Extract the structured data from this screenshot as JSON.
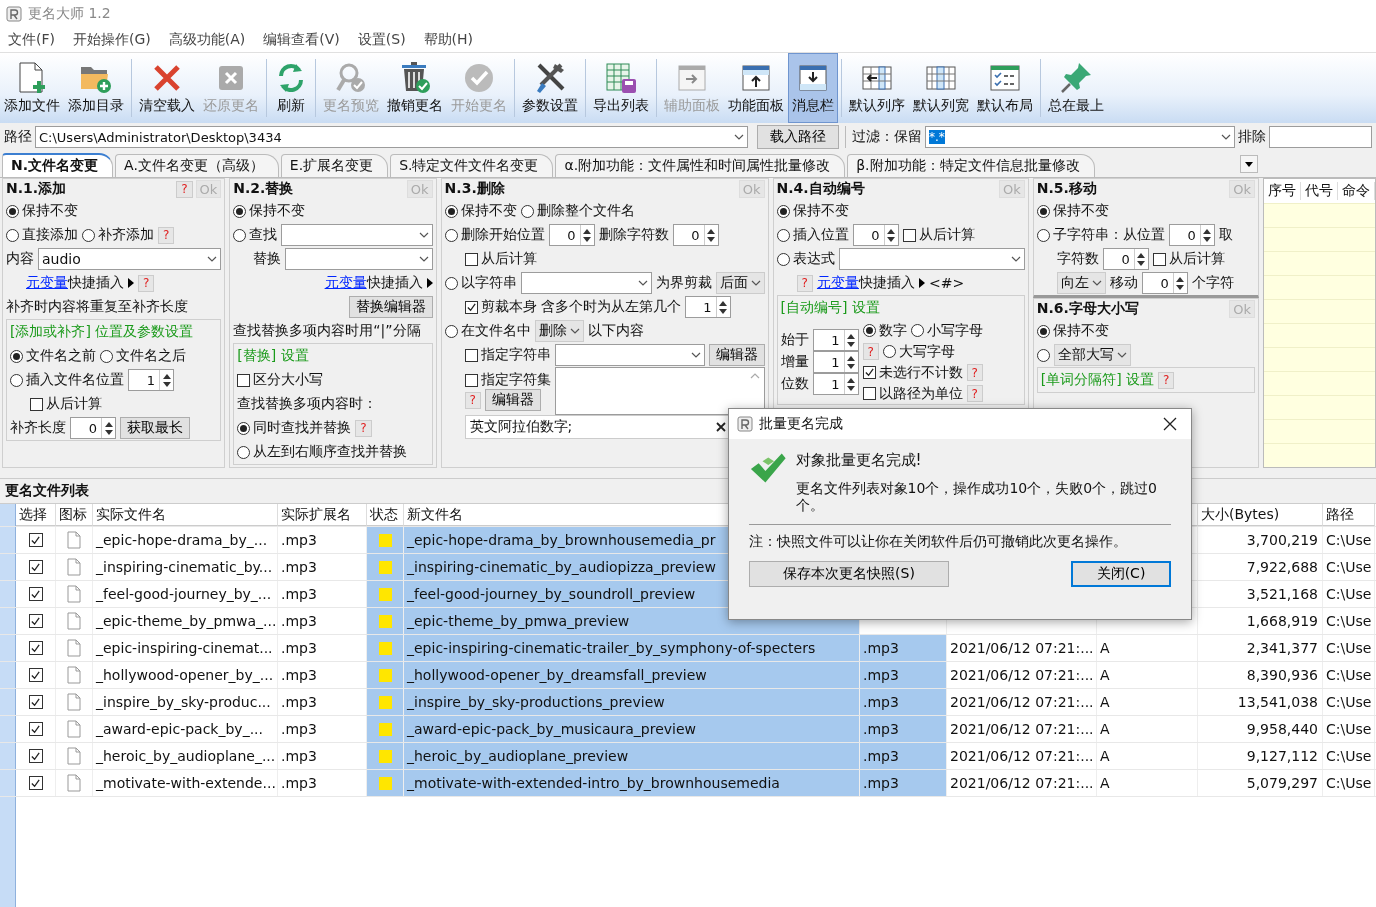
{
  "window": {
    "title": "更名大师 1.2"
  },
  "menu": [
    "文件(F)",
    "开始操作(G)",
    "高级功能(A)",
    "编辑查看(V)",
    "设置(S)",
    "帮助(H)"
  ],
  "toolbar": [
    [
      {
        "kind": "file",
        "label": "添加文件",
        "disabled": false,
        "selected": false
      },
      {
        "kind": "folder",
        "label": "添加目录",
        "disabled": false,
        "selected": false
      }
    ],
    [
      {
        "kind": "clear",
        "label": "清空载入",
        "disabled": false,
        "selected": false
      },
      {
        "kind": "restore",
        "label": "还原更名",
        "disabled": true,
        "selected": false
      }
    ],
    [
      {
        "kind": "refresh",
        "label": "刷新",
        "disabled": false,
        "selected": false
      }
    ],
    [
      {
        "kind": "preview",
        "label": "更名预览",
        "disabled": true,
        "selected": false
      },
      {
        "kind": "undo",
        "label": "撤销更名",
        "disabled": false,
        "selected": false
      },
      {
        "kind": "start",
        "label": "开始更名",
        "disabled": true,
        "selected": false
      }
    ],
    [
      {
        "kind": "tools",
        "label": "参数设置",
        "disabled": false,
        "selected": false
      }
    ],
    [
      {
        "kind": "export",
        "label": "导出列表",
        "disabled": false,
        "selected": false
      }
    ],
    [
      {
        "kind": "aux",
        "label": "辅助面板",
        "disabled": true,
        "selected": false
      },
      {
        "kind": "func",
        "label": "功能面板",
        "disabled": false,
        "selected": false
      },
      {
        "kind": "message",
        "label": "消息栏",
        "disabled": false,
        "selected": true
      }
    ],
    [
      {
        "kind": "order",
        "label": "默认列序",
        "disabled": false,
        "selected": false
      },
      {
        "kind": "width",
        "label": "默认列宽",
        "disabled": false,
        "selected": false
      },
      {
        "kind": "layout",
        "label": "默认布局",
        "disabled": false,
        "selected": false
      }
    ],
    [
      {
        "kind": "pin",
        "label": "总在最上",
        "disabled": false,
        "selected": false
      }
    ]
  ],
  "path_bar": {
    "label": "路径",
    "value": "C:\\Users\\Administrator\\Desktop\\3434",
    "load_button": "载入路径",
    "filter_label": "过滤：保留",
    "filter_value": "*.*",
    "exclude_label": "排除"
  },
  "tabs": [
    {
      "label": "N.文件名变更",
      "selected": true
    },
    {
      "label": "A.文件名变更（高级）",
      "selected": false
    },
    {
      "label": "E.扩展名变更",
      "selected": false
    },
    {
      "label": "S.特定文件文件名变更",
      "selected": false
    },
    {
      "label": "α.附加功能：文件属性和时间属性批量修改",
      "selected": false
    },
    {
      "label": "β.附加功能：特定文件信息批量修改",
      "selected": false
    }
  ],
  "panel_columns": [
    [
      {
        "title": "N.1.添加",
        "header": [
          {
            "kind": "help",
            "label": "?"
          },
          {
            "kind": "ok",
            "label": "Ok",
            "disabled": true
          }
        ],
        "blocks": [
          {
            "boxed": false,
            "rows": [
              {
                "items": [
                  {
                    "kind": "radio",
                    "label": "保持不变",
                    "selected": true
                  }
                ]
              },
              {
                "items": [
                  {
                    "kind": "radio",
                    "label": "直接添加",
                    "selected": false
                  },
                  {
                    "kind": "radio",
                    "label": "补齐添加",
                    "selected": false
                  },
                  {
                    "kind": "help",
                    "label": "?"
                  }
                ]
              },
              {
                "items": [
                  {
                    "kind": "text",
                    "label": "内容"
                  },
                  {
                    "kind": "combo",
                    "value": "audio",
                    "readonly": false
                  }
                ]
              },
              {
                "indent": true,
                "items": [
                  {
                    "kind": "link",
                    "label": "元变量"
                  },
                  {
                    "kind": "text",
                    "label": "快捷插入"
                  },
                  {
                    "kind": "arrow"
                  },
                  {
                    "kind": "help",
                    "label": "?"
                  }
                ]
              },
              {
                "items": [
                  {
                    "kind": "text",
                    "label": "补齐时内容将重复至补齐长度"
                  }
                ]
              }
            ]
          },
          {
            "boxed": true,
            "rows": [
              {
                "items": [
                  {
                    "kind": "heading",
                    "label": "[添加或补齐] 位置及参数设置"
                  }
                ]
              },
              {
                "items": [
                  {
                    "kind": "radio",
                    "label": "文件名之前",
                    "selected": true
                  },
                  {
                    "kind": "radio",
                    "label": "文件名之后",
                    "selected": false
                  }
                ]
              },
              {
                "items": [
                  {
                    "kind": "radio",
                    "label": "插入文件名位置",
                    "selected": false
                  },
                  {
                    "kind": "spin",
                    "value": "1"
                  }
                ]
              },
              {
                "indent": true,
                "items": [
                  {
                    "kind": "check",
                    "label": "从后计算",
                    "checked": false
                  }
                ]
              },
              {
                "items": [
                  {
                    "kind": "text",
                    "label": "补齐长度"
                  },
                  {
                    "kind": "spin",
                    "value": "0"
                  },
                  {
                    "kind": "button",
                    "label": "获取最长"
                  }
                ]
              }
            ]
          }
        ]
      }
    ],
    [
      {
        "title": "N.2.替换",
        "header": [
          {
            "kind": "ok",
            "label": "Ok",
            "disabled": true
          }
        ],
        "blocks": [
          {
            "boxed": false,
            "rows": [
              {
                "items": [
                  {
                    "kind": "radio",
                    "label": "保持不变",
                    "selected": true
                  }
                ]
              },
              {
                "items": [
                  {
                    "kind": "radio",
                    "label": "查找",
                    "selected": false
                  },
                  {
                    "kind": "combo",
                    "readonly": false
                  }
                ]
              },
              {
                "indent": true,
                "items": [
                  {
                    "kind": "text",
                    "label": "替换"
                  },
                  {
                    "kind": "combo",
                    "readonly": false
                  }
                ]
              },
              {
                "right": true,
                "items": [
                  {
                    "kind": "link",
                    "label": "元变量"
                  },
                  {
                    "kind": "text",
                    "label": "快捷插入"
                  },
                  {
                    "kind": "arrow"
                  }
                ]
              },
              {
                "right": true,
                "items": [
                  {
                    "kind": "button",
                    "label": "替换编辑器"
                  }
                ]
              },
              {
                "items": [
                  {
                    "kind": "text",
                    "label": "查找替换多项内容时用“|”分隔"
                  }
                ]
              }
            ]
          },
          {
            "boxed": true,
            "rows": [
              {
                "items": [
                  {
                    "kind": "heading",
                    "label": "[替换] 设置"
                  }
                ]
              },
              {
                "items": [
                  {
                    "kind": "check",
                    "label": "区分大小写",
                    "checked": false
                  }
                ]
              },
              {
                "items": [
                  {
                    "kind": "text",
                    "label": "查找替换多项内容时："
                  }
                ]
              },
              {
                "items": [
                  {
                    "kind": "radio",
                    "label": "同时查找并替换",
                    "selected": true
                  },
                  {
                    "kind": "help",
                    "label": "?"
                  }
                ]
              },
              {
                "items": [
                  {
                    "kind": "radio",
                    "label": "从左到右顺序查找并替换",
                    "selected": false
                  }
                ]
              }
            ]
          }
        ]
      }
    ],
    [
      {
        "title": "N.3.删除",
        "header": [
          {
            "kind": "ok",
            "label": "Ok",
            "disabled": true
          }
        ],
        "blocks": [
          {
            "boxed": false,
            "rows": [
              {
                "items": [
                  {
                    "kind": "radio",
                    "label": "保持不变",
                    "selected": true
                  },
                  {
                    "kind": "radio",
                    "label": "删除整个文件名",
                    "selected": false
                  }
                ]
              },
              {
                "items": [
                  {
                    "kind": "radio",
                    "label": "删除开始位置",
                    "selected": false
                  },
                  {
                    "kind": "spin",
                    "value": "0"
                  },
                  {
                    "kind": "text",
                    "label": "删除字符数"
                  },
                  {
                    "kind": "spin",
                    "value": "0"
                  }
                ]
              },
              {
                "indent": true,
                "items": [
                  {
                    "kind": "check",
                    "label": "从后计算",
                    "checked": false
                  }
                ]
              },
              {
                "items": [
                  {
                    "kind": "radio",
                    "label": "以字符串",
                    "selected": false
                  },
                  {
                    "kind": "combo",
                    "readonly": false
                  },
                  {
                    "kind": "text",
                    "label": "为界剪裁"
                  },
                  {
                    "kind": "combo",
                    "value": "后面",
                    "readonly": true
                  }
                ]
              },
              {
                "indent": true,
                "items": [
                  {
                    "kind": "check",
                    "label": "剪裁本身",
                    "checked": true
                  },
                  {
                    "kind": "text",
                    "label": "含多个时为从左第几个"
                  },
                  {
                    "kind": "spin",
                    "value": "1"
                  }
                ]
              },
              {
                "items": [
                  {
                    "kind": "radio",
                    "label": "在文件名中",
                    "selected": false
                  },
                  {
                    "kind": "combo",
                    "value": "删除",
                    "readonly": true
                  },
                  {
                    "kind": "text",
                    "label": "以下内容"
                  }
                ]
              },
              {
                "indent": true,
                "items": [
                  {
                    "kind": "check",
                    "label": "指定字符串",
                    "checked": false
                  },
                  {
                    "kind": "combo",
                    "readonly": false
                  },
                  {
                    "kind": "button",
                    "label": "编辑器"
                  }
                ]
              },
              {
                "indent": true,
                "items": [
                  {
                    "kind": "stack",
                    "items": [
                      {
                        "kind": "check",
                        "label": "指定字符集",
                        "checked": false
                      },
                      {
                        "kind": "group",
                        "items": [
                          {
                            "kind": "help",
                            "label": "?"
                          },
                          {
                            "kind": "button",
                            "label": "编辑器"
                          }
                        ]
                      }
                    ]
                  },
                  {
                    "kind": "memo"
                  }
                ]
              },
              {
                "indent": true,
                "items": [
                  {
                    "kind": "clear-field",
                    "value": "英文阿拉伯数字;"
                  }
                ]
              }
            ]
          }
        ]
      }
    ],
    [
      {
        "title": "N.4.自动编号",
        "header": [
          {
            "kind": "ok",
            "label": "Ok",
            "disabled": true
          }
        ],
        "blocks": [
          {
            "boxed": false,
            "rows": [
              {
                "items": [
                  {
                    "kind": "radio",
                    "label": "保持不变",
                    "selected": true
                  }
                ]
              },
              {
                "items": [
                  {
                    "kind": "radio",
                    "label": "插入位置",
                    "selected": false
                  },
                  {
                    "kind": "spin",
                    "value": "0"
                  },
                  {
                    "kind": "check",
                    "label": "从后计算",
                    "checked": false
                  }
                ]
              },
              {
                "items": [
                  {
                    "kind": "radio",
                    "label": "表达式",
                    "selected": false
                  },
                  {
                    "kind": "combo",
                    "readonly": false
                  }
                ]
              },
              {
                "indent": true,
                "items": [
                  {
                    "kind": "help",
                    "label": "?"
                  },
                  {
                    "kind": "link",
                    "label": "元变量"
                  },
                  {
                    "kind": "text",
                    "label": "快捷插入"
                  },
                  {
                    "kind": "arrow"
                  },
                  {
                    "kind": "text",
                    "label": "<#>"
                  }
                ]
              }
            ]
          },
          {
            "boxed": true,
            "rows": [
              {
                "items": [
                  {
                    "kind": "heading",
                    "label": "[自动编号] 设置"
                  }
                ]
              },
              {
                "items": [
                  {
                    "kind": "stack",
                    "items": [
                      {
                        "kind": "group",
                        "items": [
                          {
                            "kind": "text",
                            "label": "始于"
                          },
                          {
                            "kind": "spin",
                            "value": "1"
                          }
                        ]
                      },
                      {
                        "kind": "group",
                        "items": [
                          {
                            "kind": "text",
                            "label": "增量"
                          },
                          {
                            "kind": "spin",
                            "value": "1"
                          }
                        ]
                      },
                      {
                        "kind": "group",
                        "items": [
                          {
                            "kind": "text",
                            "label": "位数"
                          },
                          {
                            "kind": "spin",
                            "value": "1"
                          }
                        ]
                      }
                    ]
                  },
                  {
                    "kind": "stack",
                    "items": [
                      {
                        "kind": "group",
                        "items": [
                          {
                            "kind": "radio",
                            "label": "数字",
                            "selected": true
                          },
                          {
                            "kind": "radio",
                            "label": "小写字母",
                            "selected": false
                          }
                        ]
                      },
                      {
                        "kind": "group",
                        "items": [
                          {
                            "kind": "help",
                            "label": "?"
                          },
                          {
                            "kind": "radio",
                            "label": "大写字母",
                            "selected": false
                          }
                        ]
                      },
                      {
                        "kind": "group",
                        "items": [
                          {
                            "kind": "check",
                            "label": "未选行不计数",
                            "checked": true
                          },
                          {
                            "kind": "help",
                            "label": "?"
                          }
                        ]
                      },
                      {
                        "kind": "group",
                        "items": [
                          {
                            "kind": "check",
                            "label": "以路径为单位",
                            "checked": false
                          },
                          {
                            "kind": "help",
                            "label": "?"
                          }
                        ]
                      }
                    ]
                  }
                ]
              }
            ]
          }
        ]
      }
    ],
    [
      {
        "title": "N.5.移动",
        "header": [
          {
            "kind": "ok",
            "label": "Ok",
            "disabled": true
          }
        ],
        "blocks": [
          {
            "boxed": false,
            "rows": [
              {
                "items": [
                  {
                    "kind": "radio",
                    "label": "保持不变",
                    "selected": true
                  }
                ]
              },
              {
                "items": [
                  {
                    "kind": "radio",
                    "label": "子字符串：从位置",
                    "selected": false
                  },
                  {
                    "kind": "spin",
                    "value": "0"
                  },
                  {
                    "kind": "text",
                    "label": "取"
                  }
                ]
              },
              {
                "indent": true,
                "items": [
                  {
                    "kind": "text",
                    "label": "字符数"
                  },
                  {
                    "kind": "spin",
                    "value": "0"
                  },
                  {
                    "kind": "check",
                    "label": "从后计算",
                    "checked": false
                  }
                ]
              },
              {
                "indent": true,
                "items": [
                  {
                    "kind": "combo",
                    "value": "向左",
                    "readonly": true
                  },
                  {
                    "kind": "text",
                    "label": "移动"
                  },
                  {
                    "kind": "spin",
                    "value": "0"
                  },
                  {
                    "kind": "text",
                    "label": "个字符"
                  }
                ]
              }
            ]
          }
        ]
      },
      {
        "title": "N.6.字母大小写",
        "header": [
          {
            "kind": "ok",
            "label": "Ok",
            "disabled": true
          }
        ],
        "blocks": [
          {
            "boxed": false,
            "rows": [
              {
                "items": [
                  {
                    "kind": "radio",
                    "label": "保持不变",
                    "selected": true
                  }
                ]
              },
              {
                "items": [
                  {
                    "kind": "radio",
                    "selected": false
                  },
                  {
                    "kind": "combo",
                    "value": "全部大写",
                    "readonly": true
                  }
                ]
              }
            ]
          },
          {
            "boxed": true,
            "rows": [
              {
                "items": [
                  {
                    "kind": "heading",
                    "label": "[单词分隔符] 设置"
                  },
                  {
                    "kind": "help",
                    "label": "?"
                  }
                ]
              }
            ]
          }
        ]
      }
    ]
  ],
  "command_list": {
    "columns": [
      "序号",
      "代号",
      "命令"
    ]
  },
  "file_list": {
    "title": "更名文件列表",
    "columns": [
      "选择",
      "图标",
      "实际文件名",
      "实际扩展名",
      "状态",
      "新文件名",
      "大小(Bytes)",
      "路径"
    ],
    "rows": [
      {
        "checked": true,
        "name": "_epic-hope-drama_by_...",
        "ext": ".mp3",
        "new_name": "_epic-hope-drama_by_brownhousemedia_pr",
        "size": "3,700,219",
        "path": "C:\\Use"
      },
      {
        "checked": true,
        "name": "_inspiring-cinematic_by...",
        "ext": ".mp3",
        "new_name": "_inspiring-cinematic_by_audiopizza_preview",
        "size": "7,922,688",
        "path": "C:\\Use"
      },
      {
        "checked": true,
        "name": "_feel-good-journey_by_...",
        "ext": ".mp3",
        "new_name": "_feel-good-journey_by_soundroll_preview",
        "size": "3,521,168",
        "path": "C:\\Use"
      },
      {
        "checked": true,
        "name": "_epic-theme_by_pmwa_...",
        "ext": ".mp3",
        "new_name": "_epic-theme_by_pmwa_preview",
        "size": "1,668,919",
        "path": "C:\\Use"
      },
      {
        "checked": true,
        "name": "_epic-inspiring-cinemat...",
        "ext": ".mp3",
        "new_name": "_epic-inspiring-cinematic-trailer_by_symphony-of-specters",
        "new_ext": ".mp3",
        "modified": "2021/06/12 07:21:...",
        "attr": "A",
        "size": "2,341,377",
        "path": "C:\\Use"
      },
      {
        "checked": true,
        "name": "_hollywood-opener_by_...",
        "ext": ".mp3",
        "new_name": "_hollywood-opener_by_dreamsfall_preview",
        "new_ext": ".mp3",
        "modified": "2021/06/12 07:21:...",
        "attr": "A",
        "size": "8,390,936",
        "path": "C:\\Use"
      },
      {
        "checked": true,
        "name": "_inspire_by_sky-produc...",
        "ext": ".mp3",
        "new_name": "_inspire_by_sky-productions_preview",
        "new_ext": ".mp3",
        "modified": "2021/06/12 07:21:...",
        "attr": "A",
        "size": "13,541,038",
        "path": "C:\\Use"
      },
      {
        "checked": true,
        "name": "_award-epic-pack_by_...",
        "ext": ".mp3",
        "new_name": "_award-epic-pack_by_musicaura_preview",
        "new_ext": ".mp3",
        "modified": "2021/06/12 07:21:...",
        "attr": "A",
        "size": "9,958,440",
        "path": "C:\\Use"
      },
      {
        "checked": true,
        "name": "_heroic_by_audioplane_...",
        "ext": ".mp3",
        "new_name": "_heroic_by_audioplane_preview",
        "new_ext": ".mp3",
        "modified": "2021/06/12 07:21:...",
        "attr": "A",
        "size": "9,127,112",
        "path": "C:\\Use"
      },
      {
        "checked": true,
        "name": "_motivate-with-extende...",
        "ext": ".mp3",
        "new_name": "_motivate-with-extended-intro_by_brownhousemedia",
        "new_ext": ".mp3",
        "modified": "2021/06/12 07:21:...",
        "attr": "A",
        "size": "5,079,297",
        "path": "C:\\Use"
      }
    ]
  },
  "dialog": {
    "title": "批量更名完成",
    "heading": "对象批量更名完成!",
    "message": "更名文件列表对象10个，操作成功10个，失败0个，跳过0个。",
    "note": "注：快照文件可以让你在关闭软件后仍可撤销此次更名操作。",
    "buttons": [
      {
        "label": "保存本次更名快照(S)",
        "selected": false
      },
      {
        "label": "关闭(C)",
        "selected": true
      }
    ]
  }
}
